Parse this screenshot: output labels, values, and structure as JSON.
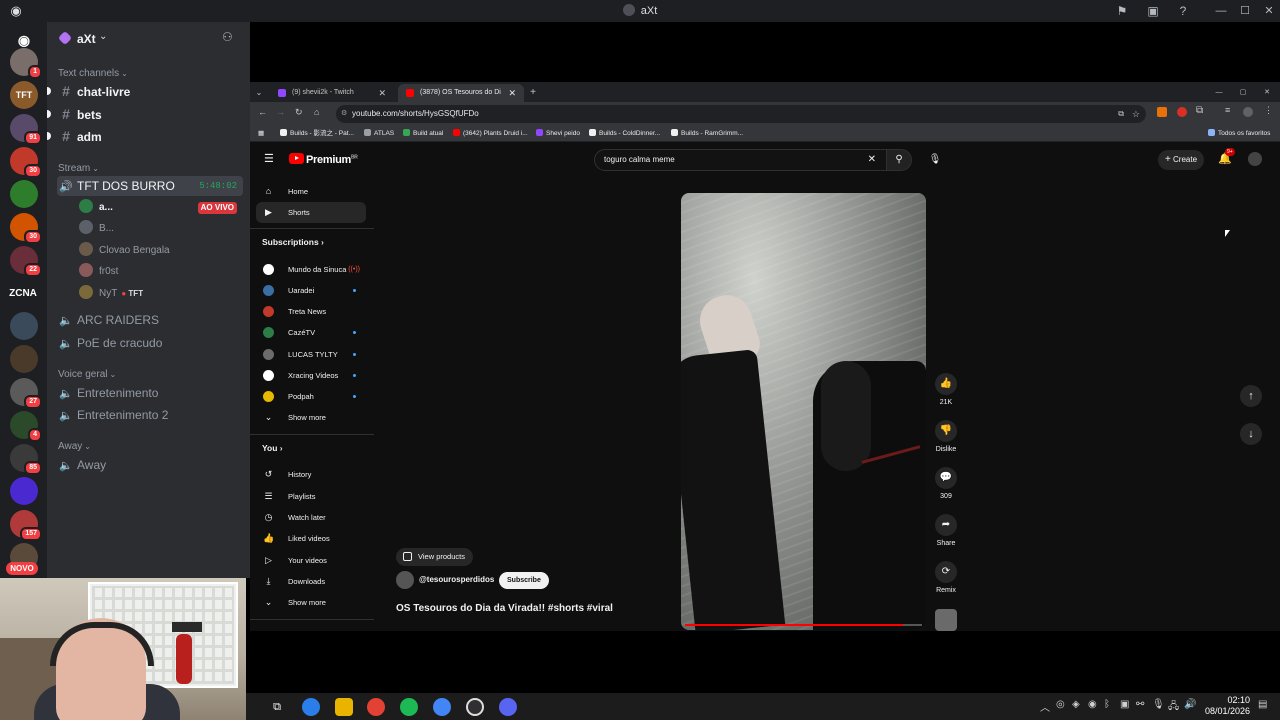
{
  "discord": {
    "window_title": "aXt",
    "server_name": "aXt",
    "categories": {
      "text": "Text channels",
      "stream": "Stream",
      "voice": "Voice geral",
      "away": "Away"
    },
    "text_channels": [
      "chat-livre",
      "bets",
      "adm"
    ],
    "stream_channel": {
      "name": "TFT DOS BURRO",
      "timer": "5:48:02"
    },
    "voice_users": [
      {
        "name": "a...",
        "live": "AO VIVO"
      },
      {
        "name": "B..."
      },
      {
        "name": "Clovao Bengala"
      },
      {
        "name": "fr0st"
      },
      {
        "name": "NyT",
        "tag": "TFT"
      }
    ],
    "stream_channels_more": [
      "ARC RAIDERS",
      "PoE de cracudo"
    ],
    "voice_channels": [
      "Entretenimento",
      "Entretenimento 2"
    ],
    "away_channels": [
      "Away"
    ],
    "server_rail": [
      {
        "badge": "1",
        "color": "#7a6e6a"
      },
      {
        "badge": "",
        "color": "#8a5a2a",
        "label": "TFT"
      },
      {
        "badge": "91",
        "color": "#5a4a6a"
      },
      {
        "badge": "30",
        "color": "#c0392b"
      },
      {
        "badge": "",
        "color": "#2d7d2d"
      },
      {
        "badge": "30",
        "color": "#d35400"
      },
      {
        "badge": "22",
        "color": "#6a2d3a"
      },
      {
        "badge": "",
        "color": "#1e1f22",
        "label": "ZCNA"
      },
      {
        "badge": "",
        "color": "#3a4a5a"
      },
      {
        "badge": "",
        "color": "#4a3a2a"
      },
      {
        "badge": "27",
        "color": "#5a5a5a"
      },
      {
        "badge": "4",
        "color": "#2a4a2a"
      },
      {
        "badge": "85",
        "color": "#3a3a3a"
      },
      {
        "badge": "",
        "color": "#4a2ad0"
      },
      {
        "badge": "157",
        "color": "#b03a3a"
      },
      {
        "badge": "",
        "color": "#5a4a3a"
      }
    ],
    "novo_label": "NOVO"
  },
  "chrome": {
    "tabs": [
      {
        "title": "(9) shevii2k - Twitch",
        "color": "#9146ff"
      },
      {
        "title": "(3878) OS Tesouros do Di",
        "color": "#ff0000",
        "active": true
      }
    ],
    "url": "youtube.com/shorts/HysGSQfUFDo",
    "bookmarks": [
      "Builds - 影流之 - Pat...",
      "ATLAS",
      "Build atual",
      "(3642) Plants Druid i...",
      "Shevi peido",
      "Builds - ColdDinner...",
      "Builds - RamGrimm..."
    ],
    "bookmarks_right": "Todos os favoritos"
  },
  "youtube": {
    "logo": "Premium",
    "logo_sup": "BR",
    "search_query": "toguro calma meme",
    "create_label": "Create",
    "notif_badge": "9+",
    "nav": [
      {
        "label": "Home",
        "icon": "⌂"
      },
      {
        "label": "Shorts",
        "icon": "▶",
        "active": true
      }
    ],
    "subscriptions_heading": "Subscriptions",
    "subscriptions": [
      {
        "label": "Mundo da Sinuca",
        "color": "#ffffff",
        "live": true
      },
      {
        "label": "Uaradei",
        "color": "#3a6ea5",
        "dot": true
      },
      {
        "label": "Treta News",
        "color": "#c0392b"
      },
      {
        "label": "CazéTV",
        "color": "#2d7d46",
        "dot": true
      },
      {
        "label": "LUCAS TYLTY",
        "color": "#6c6c6c",
        "dot": true
      },
      {
        "label": "Xracing Videos",
        "color": "#ffffff",
        "dot": true
      },
      {
        "label": "Podpah",
        "color": "#e6b800",
        "dot": true
      }
    ],
    "show_more": "Show more",
    "you_heading": "You",
    "you_items": [
      {
        "label": "History",
        "icon": "↺"
      },
      {
        "label": "Playlists",
        "icon": "☰"
      },
      {
        "label": "Watch later",
        "icon": "◷"
      },
      {
        "label": "Liked videos",
        "icon": "👍"
      },
      {
        "label": "Your videos",
        "icon": "▷"
      },
      {
        "label": "Downloads",
        "icon": "⤓"
      }
    ],
    "you_show_more": "Show more",
    "short": {
      "products_label": "View products",
      "channel": "@tesourosperdidos",
      "subscribe_label": "Subscribe",
      "title": "OS Tesouros do Dia da Virada!! #shorts #viral",
      "progress": 0.92,
      "actions": [
        {
          "icon": "👍",
          "label": "21K",
          "name": "like"
        },
        {
          "icon": "👎",
          "label": "Dislike",
          "name": "dislike"
        },
        {
          "icon": "💬",
          "label": "309",
          "name": "comments"
        },
        {
          "icon": "➦",
          "label": "Share",
          "name": "share"
        },
        {
          "icon": "⟳",
          "label": "Remix",
          "name": "remix"
        }
      ]
    }
  },
  "taskbar": {
    "time": "02:10",
    "date": "08/01/2026",
    "apps": [
      {
        "name": "task-view",
        "color": "#3a3a3a"
      },
      {
        "name": "copilot",
        "color": "#2b7de9"
      },
      {
        "name": "explorer",
        "color": "#e8b400"
      },
      {
        "name": "chrome",
        "color": "#e34133"
      },
      {
        "name": "spotify",
        "color": "#1db954"
      },
      {
        "name": "chrome-2",
        "color": "#4285f4"
      },
      {
        "name": "obs",
        "color": "#302e31"
      },
      {
        "name": "discord",
        "color": "#5865f2"
      }
    ]
  }
}
